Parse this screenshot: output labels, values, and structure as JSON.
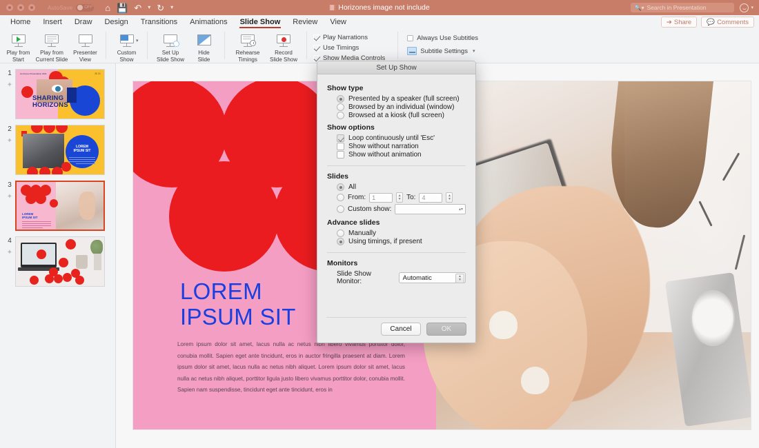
{
  "window": {
    "document_title": "Horizones image not include",
    "autosave_label": "AutoSave",
    "autosave_state": "OFF",
    "search_placeholder": "Search in Presentation",
    "quick_access": [
      "home-icon",
      "save-icon",
      "undo-icon",
      "redo-icon",
      "customize-icon"
    ]
  },
  "tabs": [
    {
      "label": "Home",
      "active": false
    },
    {
      "label": "Insert",
      "active": false
    },
    {
      "label": "Draw",
      "active": false
    },
    {
      "label": "Design",
      "active": false
    },
    {
      "label": "Transitions",
      "active": false
    },
    {
      "label": "Animations",
      "active": false
    },
    {
      "label": "Slide Show",
      "active": true
    },
    {
      "label": "Review",
      "active": false
    },
    {
      "label": "View",
      "active": false
    }
  ],
  "tab_actions": {
    "share": "Share",
    "comments": "Comments"
  },
  "ribbon": {
    "buttons": [
      {
        "label_line1": "Play from",
        "label_line2": "Start",
        "icon": "play-from-start-icon"
      },
      {
        "label_line1": "Play from",
        "label_line2": "Current Slide",
        "icon": "play-from-current-icon"
      },
      {
        "label_line1": "Presenter",
        "label_line2": "View",
        "icon": "presenter-view-icon"
      },
      {
        "label_line1": "Custom",
        "label_line2": "Show",
        "icon": "custom-show-icon"
      },
      {
        "label_line1": "Set Up",
        "label_line2": "Slide Show",
        "icon": "set-up-slide-show-icon"
      },
      {
        "label_line1": "Hide",
        "label_line2": "Slide",
        "icon": "hide-slide-icon"
      },
      {
        "label_line1": "Rehearse",
        "label_line2": "Timings",
        "icon": "rehearse-timings-icon"
      },
      {
        "label_line1": "Record",
        "label_line2": "Slide Show",
        "icon": "record-slide-show-icon"
      }
    ],
    "checkboxes": [
      {
        "label": "Play Narrations",
        "checked": true
      },
      {
        "label": "Use Timings",
        "checked": true
      },
      {
        "label": "Show Media Controls",
        "checked": true
      }
    ],
    "subtitles": {
      "always_use": "Always Use Subtitles",
      "always_use_checked": false,
      "settings_label": "Subtitle Settings"
    }
  },
  "thumbnails": [
    {
      "number": "1",
      "selected": false,
      "title": "SHARING HORIZONS",
      "corner_text": "Horizones Presentation 2021",
      "corner_text2": "20 21"
    },
    {
      "number": "2",
      "selected": false,
      "title": "LOREM IPSUM SIT"
    },
    {
      "number": "3",
      "selected": true,
      "title": "LOREM IPSUM SIT"
    },
    {
      "number": "4",
      "selected": false,
      "title": ""
    }
  ],
  "slide": {
    "title_line1": "LOREM",
    "title_line2": "IPSUM SIT",
    "body": "Lorem ipsum dolor sit amet, lacus nulla ac netus nibh libero vivamus porttitor dolor, conubia mollit. Sapien eget ante tincidunt, eros in auctor fringilla praesent at diam. Lorem ipsum dolor sit amet, lacus nulla ac netus nibh aliquet. Lorem ipsum dolor sit amet, lacus nulla ac netus nibh aliquet, porttitor ligula justo libero vivamus porttitor dolor, conubia mollit. Sapien nam suspendisse, tincidunt eget ante tincidunt, eros in",
    "title_color": "#1a3fe0",
    "background_color": "#f59ec4",
    "accent_color": "#ea1c1f"
  },
  "dialog": {
    "title": "Set Up Show",
    "show_type": {
      "heading": "Show type",
      "options": [
        {
          "label": "Presented by a speaker (full screen)",
          "selected": true
        },
        {
          "label": "Browsed by an individual (window)",
          "selected": false
        },
        {
          "label": "Browsed at a kiosk (full screen)",
          "selected": false
        }
      ]
    },
    "show_options": {
      "heading": "Show options",
      "options": [
        {
          "label": "Loop continuously until 'Esc'",
          "checked": true
        },
        {
          "label": "Show without narration",
          "checked": false
        },
        {
          "label": "Show without animation",
          "checked": false
        }
      ]
    },
    "slides": {
      "heading": "Slides",
      "all_label": "All",
      "all_selected": true,
      "from_label": "From:",
      "from_value": "1",
      "to_label": "To:",
      "to_value": "4",
      "from_selected": false,
      "custom_show_label": "Custom show:",
      "custom_show_value": "",
      "custom_show_selected": false
    },
    "advance_slides": {
      "heading": "Advance slides",
      "options": [
        {
          "label": "Manually",
          "selected": false
        },
        {
          "label": "Using timings, if present",
          "selected": true
        }
      ]
    },
    "monitors": {
      "heading": "Monitors",
      "monitor_label": "Slide Show Monitor:",
      "monitor_value": "Automatic"
    },
    "buttons": {
      "cancel": "Cancel",
      "ok": "OK"
    }
  }
}
